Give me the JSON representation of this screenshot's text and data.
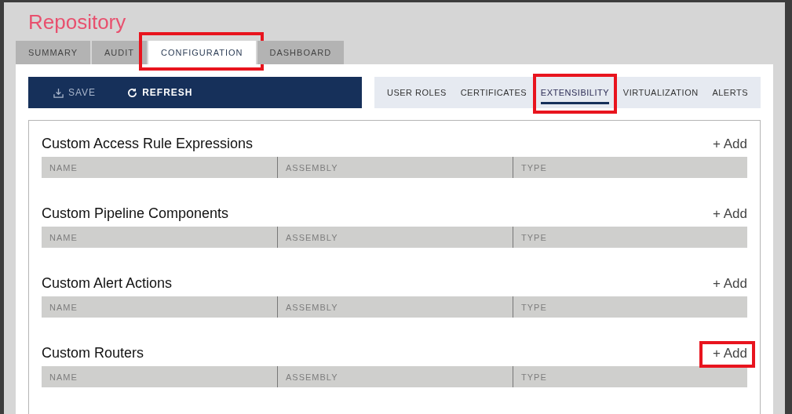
{
  "page": {
    "title": "Repository"
  },
  "tabs": [
    {
      "label": "SUMMARY",
      "selected": false,
      "highlighted": false
    },
    {
      "label": "AUDIT",
      "selected": false,
      "highlighted": false
    },
    {
      "label": "CONFIGURATION",
      "selected": true,
      "highlighted": true
    },
    {
      "label": "DASHBOARD",
      "selected": false,
      "highlighted": false
    }
  ],
  "toolbar": [
    {
      "label": "SAVE",
      "kind": "save",
      "disabled": true
    },
    {
      "label": "REFRESH",
      "kind": "refresh",
      "disabled": false
    }
  ],
  "subtabs": [
    {
      "label": "USER ROLES",
      "selected": false,
      "highlighted": false
    },
    {
      "label": "CERTIFICATES",
      "selected": false,
      "highlighted": false
    },
    {
      "label": "EXTENSIBILITY",
      "selected": true,
      "highlighted": true
    },
    {
      "label": "VIRTUALIZATION",
      "selected": false,
      "highlighted": false
    },
    {
      "label": "ALERTS",
      "selected": false,
      "highlighted": false
    }
  ],
  "sections": [
    {
      "title": "Custom Access Rule Expressions",
      "add": "+ Add",
      "add_highlighted": false,
      "columns": [
        "NAME",
        "ASSEMBLY",
        "TYPE"
      ]
    },
    {
      "title": "Custom Pipeline Components",
      "add": "+ Add",
      "add_highlighted": false,
      "columns": [
        "NAME",
        "ASSEMBLY",
        "TYPE"
      ]
    },
    {
      "title": "Custom Alert Actions",
      "add": "+ Add",
      "add_highlighted": false,
      "columns": [
        "NAME",
        "ASSEMBLY",
        "TYPE"
      ]
    },
    {
      "title": "Custom Routers",
      "add": "+ Add",
      "add_highlighted": true,
      "columns": [
        "NAME",
        "ASSEMBLY",
        "TYPE"
      ]
    }
  ]
}
